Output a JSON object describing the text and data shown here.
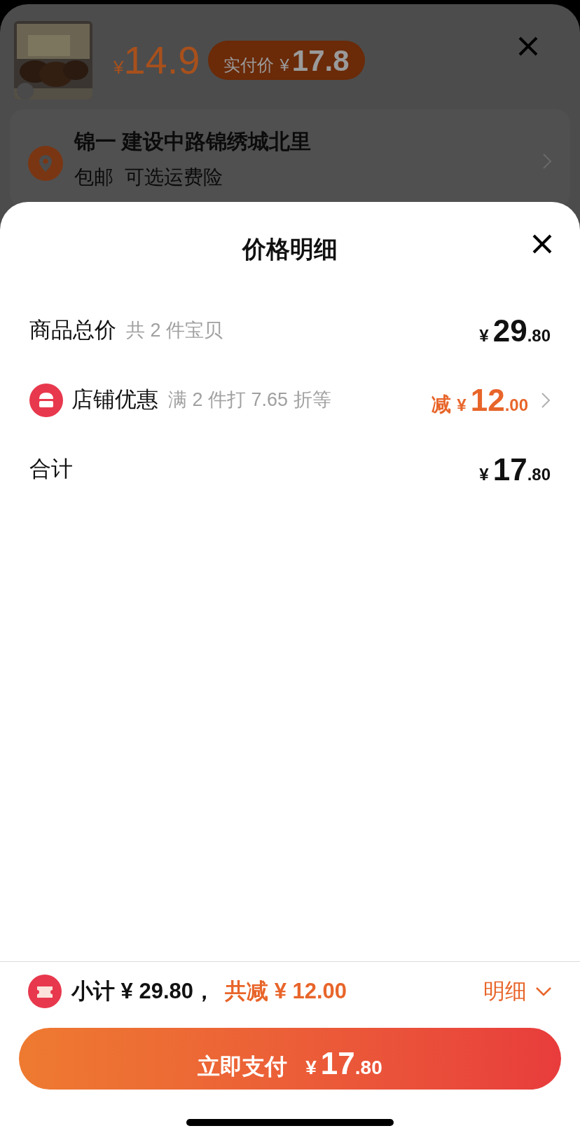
{
  "product": {
    "price": {
      "symbol": "¥",
      "amount": "14.9"
    },
    "paid_badge": {
      "label": "实付价",
      "symbol": "¥",
      "amount": "17.8"
    }
  },
  "address": {
    "line": "锦一 建设中路锦绣城北里",
    "shipping": "包邮",
    "insurance": "可选运费险"
  },
  "sheet": {
    "title": "价格明细",
    "rows": [
      {
        "kind": "plain",
        "label": "商品总价",
        "note": "共 2 件宝贝",
        "prefix": "",
        "symbol": "¥",
        "integer": "29",
        "decimal": ".80",
        "accent": false,
        "chevron": false
      },
      {
        "kind": "icon",
        "label": "店铺优惠",
        "note": "满 2 件打 7.65 折等",
        "prefix": "减",
        "symbol": "¥",
        "integer": "12",
        "decimal": ".00",
        "accent": true,
        "chevron": true
      },
      {
        "kind": "plain",
        "label": "合计",
        "symbol": "¥",
        "integer": "17",
        "decimal": ".80",
        "accent": false,
        "chevron": false
      }
    ]
  },
  "footer": {
    "subtotal": "小计 ¥ 29.80，",
    "discount": "共减 ¥ 12.00",
    "detail_link": "明细",
    "pay_button": {
      "label": "立即支付",
      "symbol": "¥",
      "integer": "17",
      "decimal": ".80"
    }
  }
}
